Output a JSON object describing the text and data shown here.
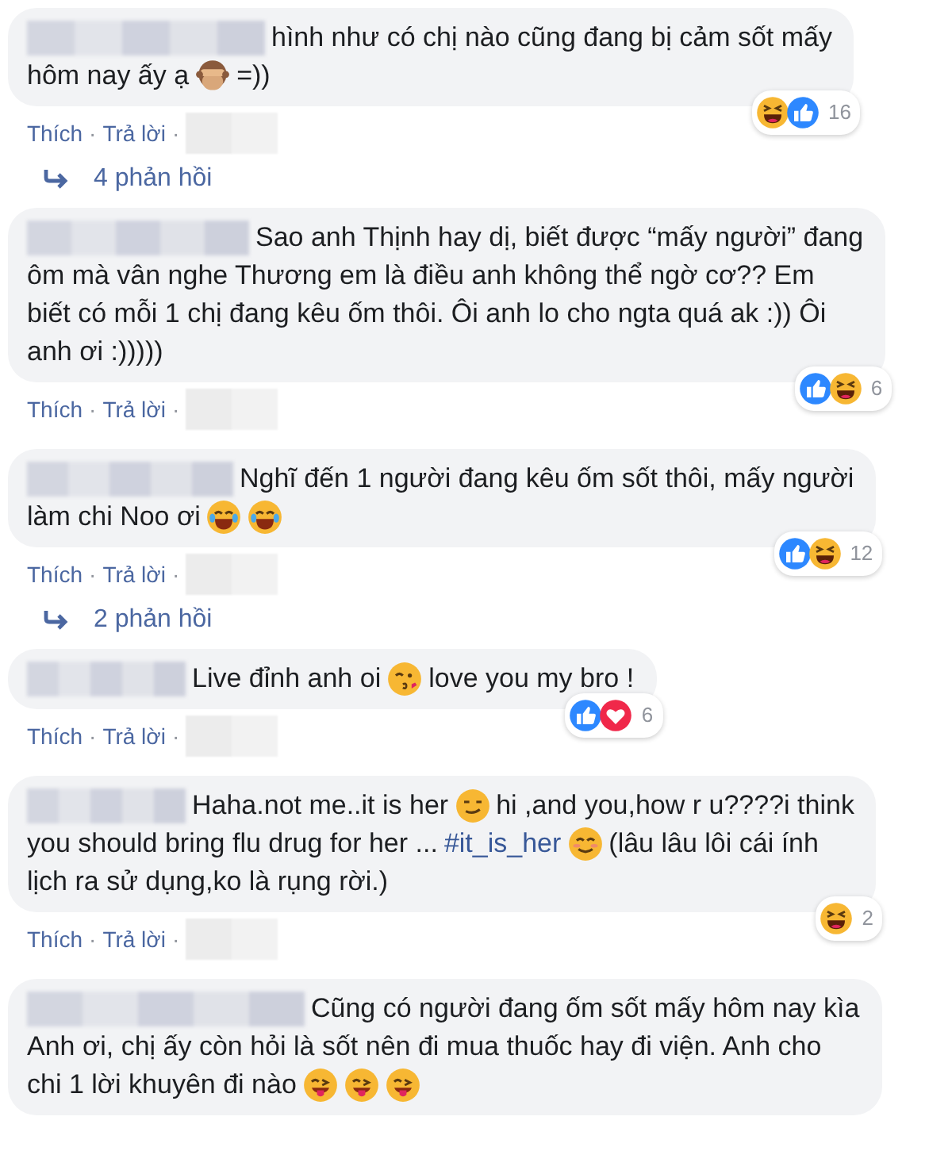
{
  "comments": [
    {
      "lines": [
        [
          {
            "kind": "text",
            "text": "hình như có chị nào cũng đang bị cảm sốt mấy"
          }
        ],
        [
          {
            "kind": "text",
            "text": "hôm nay ấy ạ"
          },
          {
            "kind": "monkey"
          },
          {
            "kind": "text",
            "text": "=))"
          }
        ]
      ],
      "reactions": {
        "icons": [
          {
            "kind": "haha"
          },
          {
            "kind": "like"
          }
        ],
        "count": "16"
      },
      "actions": [
        {
          "label": "Thích",
          "separator": "·"
        },
        {
          "label": "Trả lời",
          "separator": "·"
        }
      ],
      "replies": "4 phản hồi"
    },
    {
      "lines": [
        [
          {
            "kind": "text",
            "text": "Sao anh Thịnh hay dị, biết được “mấy người” đang"
          }
        ],
        [
          {
            "kind": "text",
            "text": "ôm mà vân nghe Thương em là điều anh không thể ngờ cơ?? Em"
          }
        ],
        [
          {
            "kind": "text",
            "text": "biết có mỗi 1 chị đang kêu ốm thôi. Ôi anh lo cho ngta quá ak :)) Ôi"
          }
        ],
        [
          {
            "kind": "text",
            "text": "anh ơi :)))))"
          }
        ]
      ],
      "reactions": {
        "icons": [
          {
            "kind": "like"
          },
          {
            "kind": "haha"
          }
        ],
        "count": "6"
      },
      "actions": [
        {
          "label": "Thích",
          "separator": "·"
        },
        {
          "label": "Trả lời",
          "separator": "·"
        }
      ]
    },
    {
      "lines": [
        [
          {
            "kind": "text",
            "text": "Nghĩ đến 1 người đang kêu ốm sốt thôi, mấy người"
          }
        ],
        [
          {
            "kind": "text",
            "text": "làm chi Noo ơi"
          },
          {
            "kind": "tears"
          },
          {
            "kind": "tears"
          }
        ]
      ],
      "reactions": {
        "icons": [
          {
            "kind": "like"
          },
          {
            "kind": "haha"
          }
        ],
        "count": "12"
      },
      "actions": [
        {
          "label": "Thích",
          "separator": "·"
        },
        {
          "label": "Trả lời",
          "separator": "·"
        }
      ],
      "replies": "2 phản hồi"
    },
    {
      "lines": [
        [
          {
            "kind": "text",
            "text": "Live đỉnh anh oi"
          },
          {
            "kind": "kiss"
          },
          {
            "kind": "text",
            "text": "love you my bro !"
          }
        ]
      ],
      "reactions": {
        "icons": [
          {
            "kind": "like"
          },
          {
            "kind": "love"
          }
        ],
        "count": "6"
      },
      "actions": [
        {
          "label": "Thích",
          "separator": "·"
        },
        {
          "label": "Trả lời",
          "separator": "·"
        }
      ]
    },
    {
      "lines": [
        [
          {
            "kind": "text",
            "text": "Haha.not me..it is her"
          },
          {
            "kind": "smirk"
          },
          {
            "kind": "text",
            "text": "hi ,and you,how r u????i think"
          }
        ],
        [
          {
            "kind": "text",
            "text": "you should bring flu drug for her ..."
          },
          {
            "kind": "link",
            "text": "#it_is_her"
          },
          {
            "kind": "smile"
          },
          {
            "kind": "text",
            "text": "(lâu lâu lôi cái ính"
          }
        ],
        [
          {
            "kind": "text",
            "text": "lịch ra sử dụng,ko là rụng rời.)"
          }
        ]
      ],
      "reactions": {
        "icons": [
          {
            "kind": "haha"
          }
        ],
        "count": "2"
      },
      "actions": [
        {
          "label": "Thích",
          "separator": "·"
        },
        {
          "label": "Trả lời",
          "separator": "·"
        }
      ]
    },
    {
      "lines": [
        [
          {
            "kind": "text",
            "text": "Cũng có người đang ốm sốt mấy hôm nay kìa"
          }
        ],
        [
          {
            "kind": "text",
            "text": "Anh ơi, chị ấy còn hỏi là sốt nên đi mua thuốc hay đi viện. Anh cho"
          }
        ],
        [
          {
            "kind": "text",
            "text": "chi 1 lời khuyên đi nào"
          },
          {
            "kind": "tongue"
          },
          {
            "kind": "tongue"
          },
          {
            "kind": "tongue"
          }
        ]
      ]
    }
  ]
}
